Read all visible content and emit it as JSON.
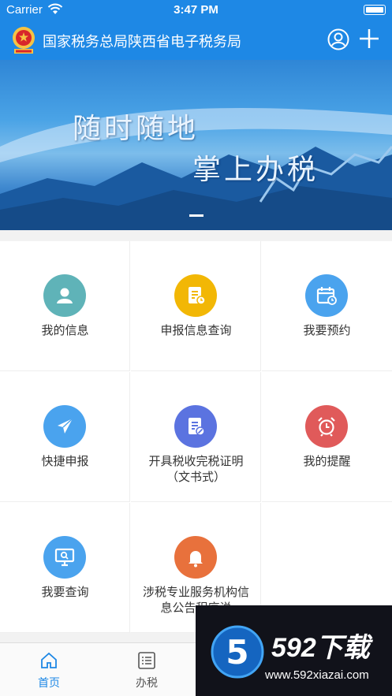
{
  "status_bar": {
    "carrier": "Carrier",
    "time": "3:47 PM"
  },
  "nav": {
    "title": "国家税务总局陕西省电子税务局"
  },
  "banner": {
    "line1": "随时随地",
    "line2": "掌上办税"
  },
  "grid": {
    "items": [
      {
        "label": "我的信息",
        "icon": "user-icon",
        "color": "#5fb3b8"
      },
      {
        "label": "申报信息查询",
        "icon": "document-clock-icon",
        "color": "#f2b705"
      },
      {
        "label": "我要预约",
        "icon": "calendar-icon",
        "color": "#4aa3ee"
      },
      {
        "label": "快捷申报",
        "icon": "paper-plane-icon",
        "color": "#4aa3ee"
      },
      {
        "label": "开具税收完税证明（文书式）",
        "icon": "document-edit-icon",
        "color": "#5b73e0"
      },
      {
        "label": "我的提醒",
        "icon": "alarm-clock-icon",
        "color": "#e05a5a"
      },
      {
        "label": "我要查询",
        "icon": "monitor-search-icon",
        "color": "#4aa3ee"
      },
      {
        "label": "涉税专业服务机构信息公告程序说",
        "icon": "bell-icon",
        "color": "#e8713c"
      }
    ]
  },
  "tabbar": {
    "tabs": [
      {
        "label": "首页",
        "icon": "home-icon"
      },
      {
        "label": "办税",
        "icon": "list-icon"
      }
    ]
  },
  "watermark": {
    "brand": "592下载",
    "site": "www.592xiazai.com"
  }
}
